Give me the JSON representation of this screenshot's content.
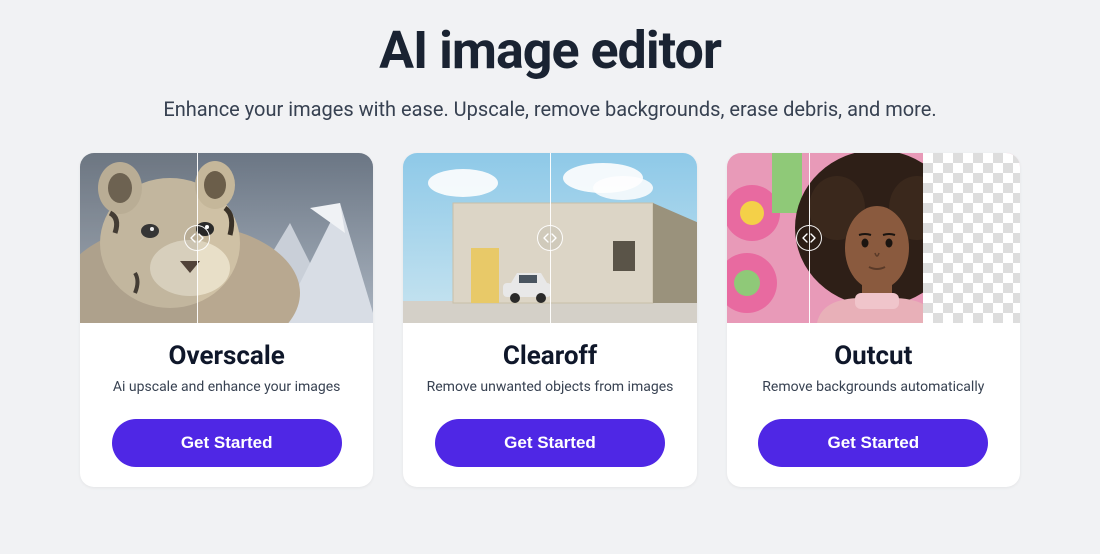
{
  "header": {
    "title": "AI image editor",
    "subtitle": "Enhance your images with ease. Upscale, remove backgrounds, erase debris, and more."
  },
  "cards": [
    {
      "title": "Overscale",
      "description": "Ai upscale and enhance your images",
      "cta": "Get Started",
      "icon": "compare-slider-icon"
    },
    {
      "title": "Clearoff",
      "description": "Remove unwanted objects from images",
      "cta": "Get Started",
      "icon": "compare-slider-icon"
    },
    {
      "title": "Outcut",
      "description": "Remove backgrounds automatically",
      "cta": "Get Started",
      "icon": "compare-slider-icon"
    }
  ],
  "colors": {
    "accent": "#4f27e5",
    "background": "#f1f2f4",
    "text_dark": "#1a2332"
  }
}
